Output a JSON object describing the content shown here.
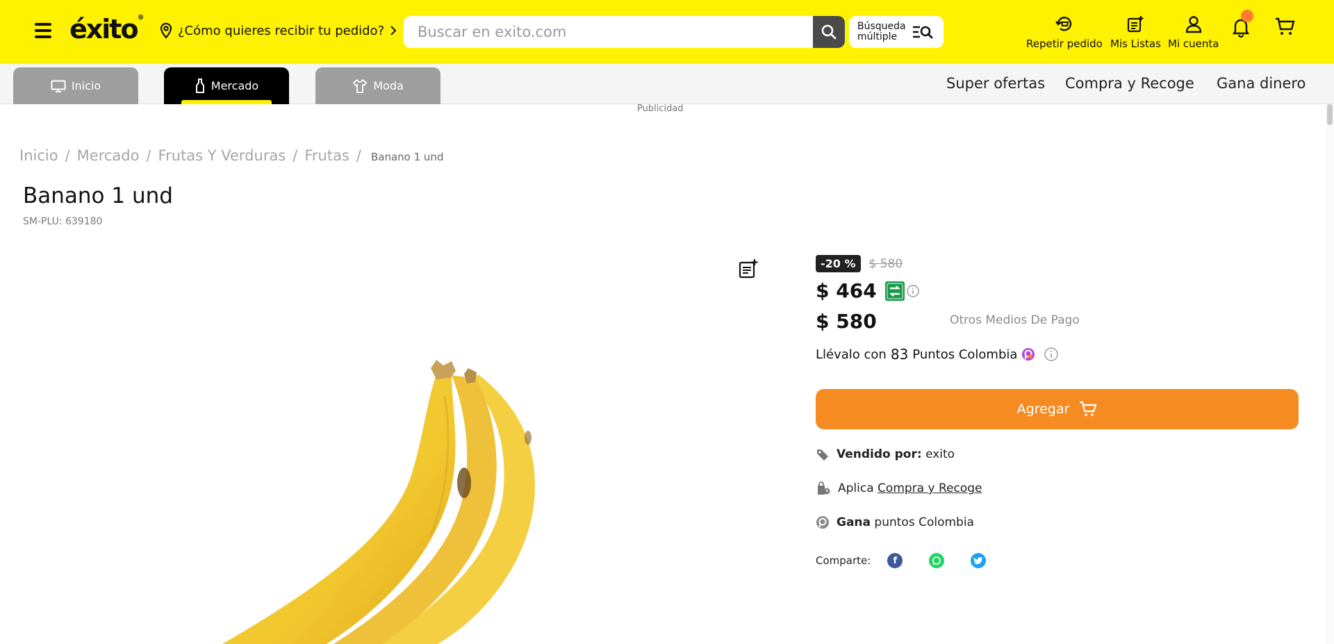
{
  "header": {
    "logo_text": "éxito",
    "delivery_prompt": "¿Cómo quieres recibir tu pedido?",
    "search_placeholder": "Buscar en exito.com",
    "multi_search_line1": "Búsqueda",
    "multi_search_line2": "múltiple",
    "repeat_order": "Repetir pedido",
    "my_lists": "Mis Listas",
    "my_account": "Mi cuenta"
  },
  "nav": {
    "tabs": [
      {
        "label": "Inicio"
      },
      {
        "label": "Mercado"
      },
      {
        "label": "Moda"
      }
    ],
    "links": [
      "Super ofertas",
      "Compra y Recoge",
      "Gana dinero"
    ]
  },
  "ad_label": "Publicidad",
  "breadcrumb": [
    "Inicio",
    "Mercado",
    "Frutas Y Verduras",
    "Frutas",
    "Banano 1 und"
  ],
  "product": {
    "title": "Banano 1 und",
    "plu": "SM-PLU: 639180",
    "discount_badge": "-20 %",
    "old_price": "$ 580",
    "card_price": "$ 464",
    "other_price": "$ 580",
    "other_payment_label": "Otros Medios De Pago",
    "points_prefix": "Llévalo con",
    "points_value": "83",
    "points_suffix": "Puntos Colombia",
    "add_button": "Agregar",
    "sold_by_label": "Vendido por:",
    "sold_by_value": "exito",
    "applies_label": "Aplica",
    "applies_link": "Compra y Recoge",
    "earn_label": "Gana",
    "earn_value": "puntos Colombia",
    "share_label": "Comparte:"
  },
  "colors": {
    "brand_yellow": "#fff200",
    "add_orange": "#f68b21",
    "notification": "#ff7a33",
    "facebook": "#3b5998",
    "whatsapp": "#25d366",
    "twitter": "#1da1f2"
  },
  "icons": [
    "menu-icon",
    "location-pin-icon",
    "chevron-right-icon",
    "search-icon",
    "multi-search-icon",
    "repeat-order-icon",
    "list-icon",
    "user-icon",
    "bell-icon",
    "cart-icon",
    "monitor-icon",
    "bottle-icon",
    "shirt-icon",
    "add-to-list-icon",
    "card-payment-icon",
    "info-icon",
    "puntos-colombia-icon",
    "tag-icon",
    "store-pickup-icon",
    "facebook-icon",
    "whatsapp-icon",
    "twitter-icon"
  ]
}
